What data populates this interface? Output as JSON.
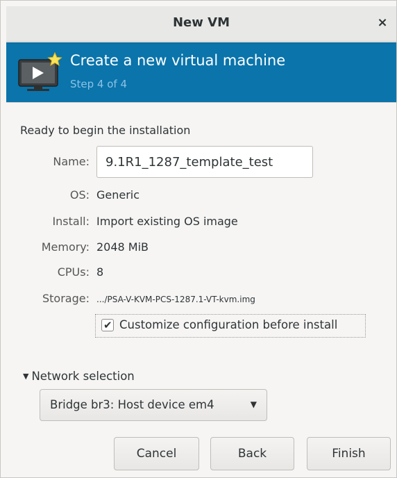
{
  "window": {
    "title": "New VM",
    "close_label": "×"
  },
  "banner": {
    "title": "Create a new virtual machine",
    "subtitle": "Step 4 of 4",
    "icon": "monitor-play-star-icon"
  },
  "form": {
    "heading": "Ready to begin the installation",
    "name_label": "Name:",
    "name_value": "9.1R1_1287_template_test",
    "os_label": "OS:",
    "os_value": "Generic",
    "install_label": "Install:",
    "install_value": "Import existing OS image",
    "memory_label": "Memory:",
    "memory_value": "2048 MiB",
    "cpus_label": "CPUs:",
    "cpus_value": "8",
    "storage_label": "Storage:",
    "storage_value": ".../PSA-V-KVM-PCS-1287.1-VT-kvm.img",
    "customize_label": "Customize configuration before install",
    "customize_checked": true
  },
  "network": {
    "expander_label": "Network selection",
    "selected": "Bridge br3: Host device em4"
  },
  "buttons": {
    "cancel": "Cancel",
    "back": "Back",
    "finish": "Finish"
  },
  "colors": {
    "banner_bg": "#0a74ab",
    "banner_subtitle": "#8cc2e6"
  }
}
